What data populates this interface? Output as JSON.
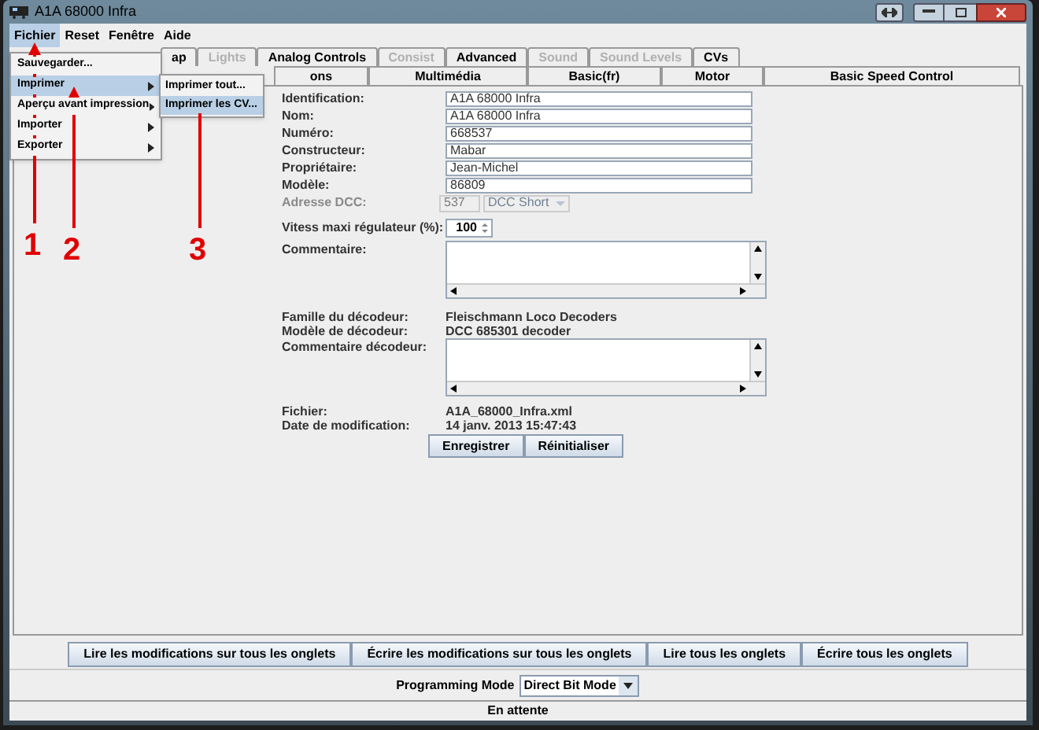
{
  "window": {
    "title": "A1A 68000 Infra"
  },
  "menubar": [
    {
      "label": "Fichier",
      "selected": true
    },
    {
      "label": "Reset",
      "selected": false
    },
    {
      "label": "Fenêtre",
      "selected": false
    },
    {
      "label": "Aide",
      "selected": false
    }
  ],
  "menu": [
    {
      "label": "Sauvegarder...",
      "selected": false,
      "submenu": false
    },
    {
      "label": "Imprimer",
      "selected": true,
      "submenu": true
    },
    {
      "label": "Aperçu avant impression",
      "selected": false,
      "submenu": true
    },
    {
      "label": "Importer",
      "selected": false,
      "submenu": true
    },
    {
      "label": "Exporter",
      "selected": false,
      "submenu": true
    }
  ],
  "submenu": [
    {
      "label": "Imprimer tout...",
      "selected": false
    },
    {
      "label": "Imprimer les CV...",
      "selected": true
    }
  ],
  "tabs_row_1": [
    {
      "label": "ap",
      "disabled": false
    },
    {
      "label": "Lights",
      "disabled": true
    },
    {
      "label": "Analog Controls",
      "disabled": false
    },
    {
      "label": "Consist",
      "disabled": true
    },
    {
      "label": "Advanced",
      "disabled": false
    },
    {
      "label": "Sound",
      "disabled": true
    },
    {
      "label": "Sound Levels",
      "disabled": true
    },
    {
      "label": "CVs",
      "disabled": false
    }
  ],
  "tabs_row_2": [
    {
      "label": "ons"
    },
    {
      "label": "Multimédia"
    },
    {
      "label": "Basic(fr)"
    },
    {
      "label": "Motor"
    },
    {
      "label": "Basic Speed Control"
    }
  ],
  "fields": [
    {
      "label": "Identification:",
      "value": "A1A 68000 Infra"
    },
    {
      "label": "Nom:",
      "value": "A1A 68000 Infra"
    },
    {
      "label": "Numéro:",
      "value": "668537"
    },
    {
      "label": "Constructeur:",
      "value": "Mabar"
    },
    {
      "label": "Propriétaire:",
      "value": "Jean-Michel"
    },
    {
      "label": "Modèle:",
      "value": "86809"
    }
  ],
  "dcc": {
    "label": "Adresse DCC:",
    "address": "537",
    "type": "DCC Short",
    "disabled": true
  },
  "speed": {
    "label": "Vitess maxi régulateur (%):",
    "value": "100"
  },
  "comment": {
    "label": "Commentaire:"
  },
  "decoder": [
    {
      "label": "Famille du décodeur:",
      "value": "Fleischmann Loco Decoders"
    },
    {
      "label": "Modèle de décodeur:",
      "value": "DCC 685301 decoder"
    }
  ],
  "decoder_comment": {
    "label": "Commentaire décodeur:"
  },
  "file": [
    {
      "label": "Fichier:",
      "value": "A1A_68000_Infra.xml"
    },
    {
      "label": "Date de modification:",
      "value": "14 janv. 2013 15:47:43"
    }
  ],
  "form_buttons": [
    "Enregistrer",
    "Réinitialiser"
  ],
  "bottom_buttons": [
    "Lire les modifications sur tous les onglets",
    "Écrire les modifications sur tous les onglets",
    "Lire tous les onglets",
    "Écrire tous les onglets"
  ],
  "programming": {
    "label": "Programming Mode",
    "value": "Direct Bit Mode"
  },
  "status": "En attente",
  "annotations": [
    {
      "label": "1"
    },
    {
      "label": "2"
    },
    {
      "label": "3"
    }
  ]
}
